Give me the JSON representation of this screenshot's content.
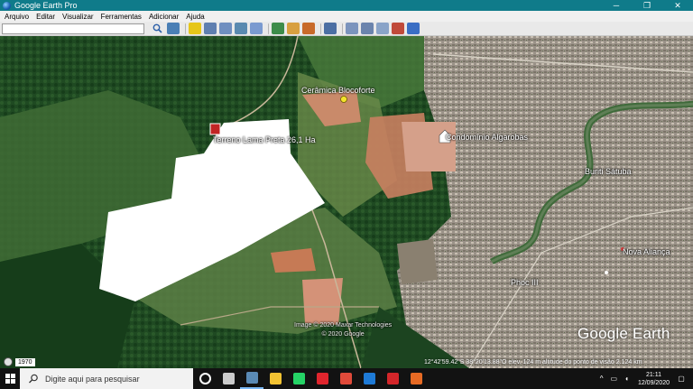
{
  "window": {
    "title": "Google Earth Pro",
    "minimize_icon": "minimize-icon",
    "maximize_icon": "maximize-icon",
    "close_icon": "close-icon",
    "minimize_glyph": "─",
    "maximize_glyph": "❐",
    "close_glyph": "✕"
  },
  "menu": [
    {
      "label": "Arquivo"
    },
    {
      "label": "Editar"
    },
    {
      "label": "Visualizar"
    },
    {
      "label": "Ferramentas"
    },
    {
      "label": "Adicionar"
    },
    {
      "label": "Ajuda"
    }
  ],
  "toolbar": {
    "search_placeholder": "",
    "search_icon": "search-icon",
    "buttons": [
      {
        "name": "sidebar-toggle-icon",
        "color": "#4a7fb5"
      },
      {
        "name": "add-placemark-icon",
        "color": "#e6c619"
      },
      {
        "name": "add-polygon-icon",
        "color": "#5f7fb0"
      },
      {
        "name": "add-path-icon",
        "color": "#6f8fc0"
      },
      {
        "name": "add-overlay-icon",
        "color": "#5a8ab0"
      },
      {
        "name": "record-tour-icon",
        "color": "#7a9ad0"
      },
      {
        "name": "historical-imagery-icon",
        "color": "#3d8c4a"
      },
      {
        "name": "sunlight-icon",
        "color": "#d8a040"
      },
      {
        "name": "switch-to-sky-icon",
        "color": "#c86a2a"
      },
      {
        "name": "ruler-icon",
        "color": "#4c6fa3"
      },
      {
        "name": "email-icon",
        "color": "#7b94bd"
      },
      {
        "name": "print-icon",
        "color": "#6b84ad"
      },
      {
        "name": "save-image-icon",
        "color": "#8aa4c8"
      },
      {
        "name": "view-in-maps-icon",
        "color": "#c04a3a"
      },
      {
        "name": "earth-gallery-icon",
        "color": "#3a6ec4"
      }
    ]
  },
  "map": {
    "labels": {
      "ceramica": "Cerâmica Blocoforte",
      "terreno": "Terreno Lama Preta 26,1 Ha",
      "condominio": "Condomínio Algarobas",
      "burit": "Buriti Sátuba",
      "nova": "Nova Aliança",
      "phoc": "Phoc III"
    },
    "credits_line1": "Image © 2020 Maxar Technologies",
    "credits_line2": "© 2020 Google",
    "logo": "Google Earth",
    "historical_year": "1970",
    "status": "12°42'59.42\"S  38°20'13.88\"O  elev. 124 m   altitude do ponto de visão 2.124 km",
    "polygon_color": "#ffffff"
  },
  "taskbar": {
    "search_placeholder": "Digite aqui para pesquisar",
    "apps": [
      {
        "name": "cortana-icon",
        "color": "#ffffff",
        "active": false
      },
      {
        "name": "task-view-icon",
        "color": "#cccccc",
        "active": false
      },
      {
        "name": "google-earth-task-icon",
        "color": "#5a8ab5",
        "active": true
      },
      {
        "name": "file-explorer-icon",
        "color": "#f2c232",
        "active": false
      },
      {
        "name": "whatsapp-icon",
        "color": "#25d366",
        "active": false
      },
      {
        "name": "opera-icon",
        "color": "#e0252d",
        "active": false
      },
      {
        "name": "chrome-icon",
        "color": "#e04a3a",
        "active": false
      },
      {
        "name": "edge-icon",
        "color": "#1e7ad6",
        "active": false
      },
      {
        "name": "pdf-reader-icon",
        "color": "#d4262a",
        "active": false
      },
      {
        "name": "firefox-icon",
        "color": "#e66a24",
        "active": false
      }
    ],
    "clock_time": "21:11",
    "clock_date": "12/09/2020"
  }
}
